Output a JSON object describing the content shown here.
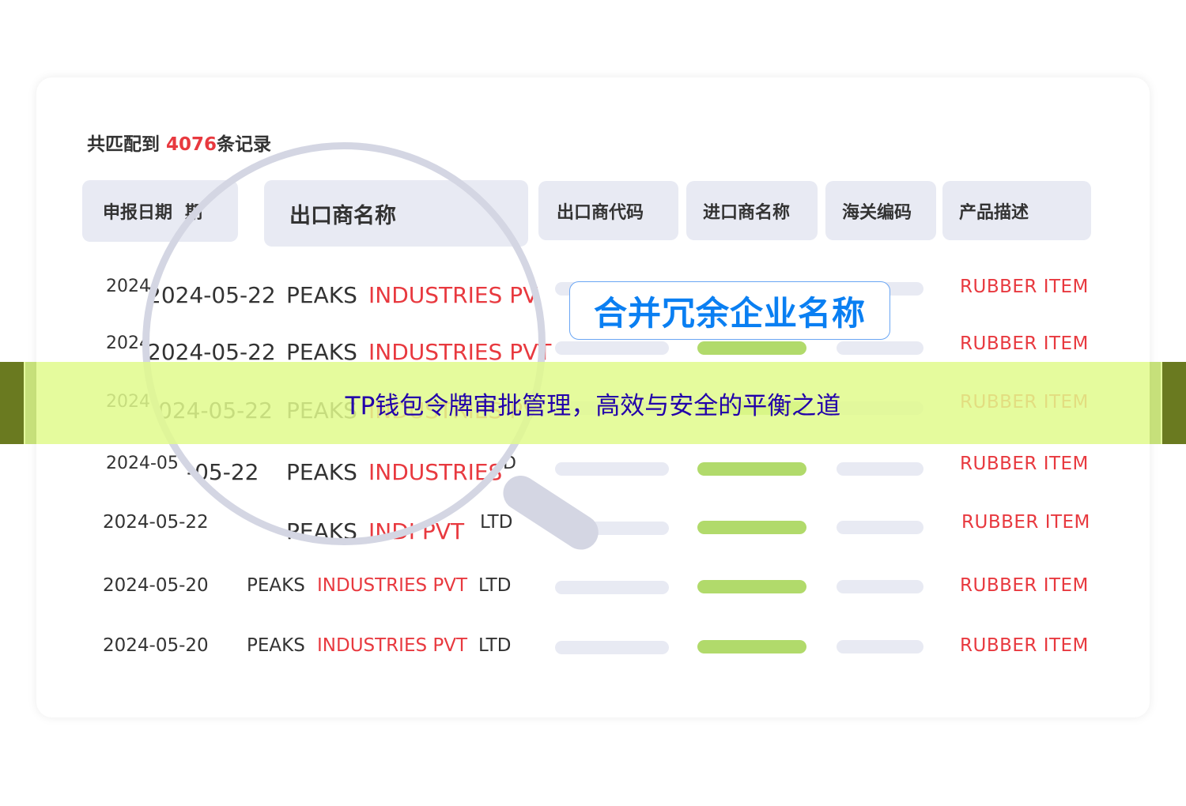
{
  "summary": {
    "prefix": "共匹配到",
    "count": "4076",
    "suffix": "条记录"
  },
  "headers": [
    {
      "label": "申报日期"
    },
    {
      "label": "出口商名称"
    },
    {
      "label": "出口商代码"
    },
    {
      "label": "进口商名称"
    },
    {
      "label": "海关编码"
    },
    {
      "label": "产品描述"
    }
  ],
  "header_ghost": "期",
  "rows": [
    {
      "date": "2024-05-22",
      "exporter_first": "PEAKS",
      "exporter_red": "INDUSTRIES PV",
      "exporter_tail": "",
      "product": "RUBBER ITEM",
      "date_ghost": "2024"
    },
    {
      "date": "2024-05-22",
      "exporter_first": "PEAKS",
      "exporter_red": "INDUSTRIES PVT",
      "exporter_tail": "",
      "product": "RUBBER ITEM",
      "date_ghost": "2024"
    },
    {
      "date": "024-05-22",
      "exporter_first": "PEAKS",
      "exporter_red": "INDUSTRIES PV",
      "exporter_tail": "",
      "product": "RUBBER ITEM",
      "date_ghost": "2024"
    },
    {
      "date": "-05-22",
      "exporter_first": "PEAKS",
      "exporter_red": "INDUSTRIES",
      "exporter_tail": "D",
      "product": "RUBBER ITEM",
      "date_ghost": "2024-05"
    },
    {
      "date": "2024-05-22",
      "exporter_first": "PEAKS",
      "exporter_red": "INDI   PVT",
      "exporter_tail": "LTD",
      "product": "RUBBER ITEM"
    },
    {
      "date": "2024-05-20",
      "exporter_first": "PEAKS",
      "exporter_red": "INDUSTRIES PVT",
      "exporter_tail": "LTD",
      "product": "RUBBER ITEM"
    },
    {
      "date": "2024-05-20",
      "exporter_first": "PEAKS",
      "exporter_red": "INDUSTRIES PVT",
      "exporter_tail": "LTD",
      "product": "RUBBER ITEM"
    }
  ],
  "callout": "合并冗余企业名称",
  "banner": "TP钱包令牌审批管理，高效与安全的平衡之道",
  "colors": {
    "accent_red": "#e8393f",
    "accent_blue": "#0a7ff2",
    "pill_green": "#b1da6b",
    "pill_gray": "#e8eaf3",
    "banner_bg": "#e4fa96",
    "banner_text": "#2200aa"
  }
}
